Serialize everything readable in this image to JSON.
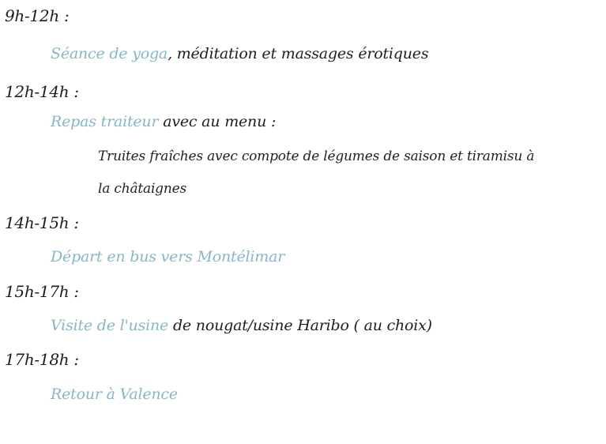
{
  "schedule": [
    {
      "time": "9h-12h :",
      "highlight": "Séance de yoga",
      "rest": ", méditation et massages érotiques"
    },
    {
      "time": "12h-14h :",
      "highlight": "Repas traiteur",
      "rest": " avec au menu :",
      "menu_line_1": "Truites fraîches avec compote de légumes de saison et tiramisu à",
      "menu_line_2": "la châtaignes"
    },
    {
      "time": "14h-15h :",
      "highlight": "Départ en bus vers Montélimar",
      "rest": ""
    },
    {
      "time": "15h-17h :",
      "highlight": "Visite de l'usine",
      "rest": " de nougat/usine Haribo ( au choix)"
    },
    {
      "time": "17h-18h :",
      "highlight": "Retour à Valence",
      "rest": ""
    }
  ],
  "colors": {
    "accent": "#86b7c6",
    "text": "#1e1e1e"
  }
}
